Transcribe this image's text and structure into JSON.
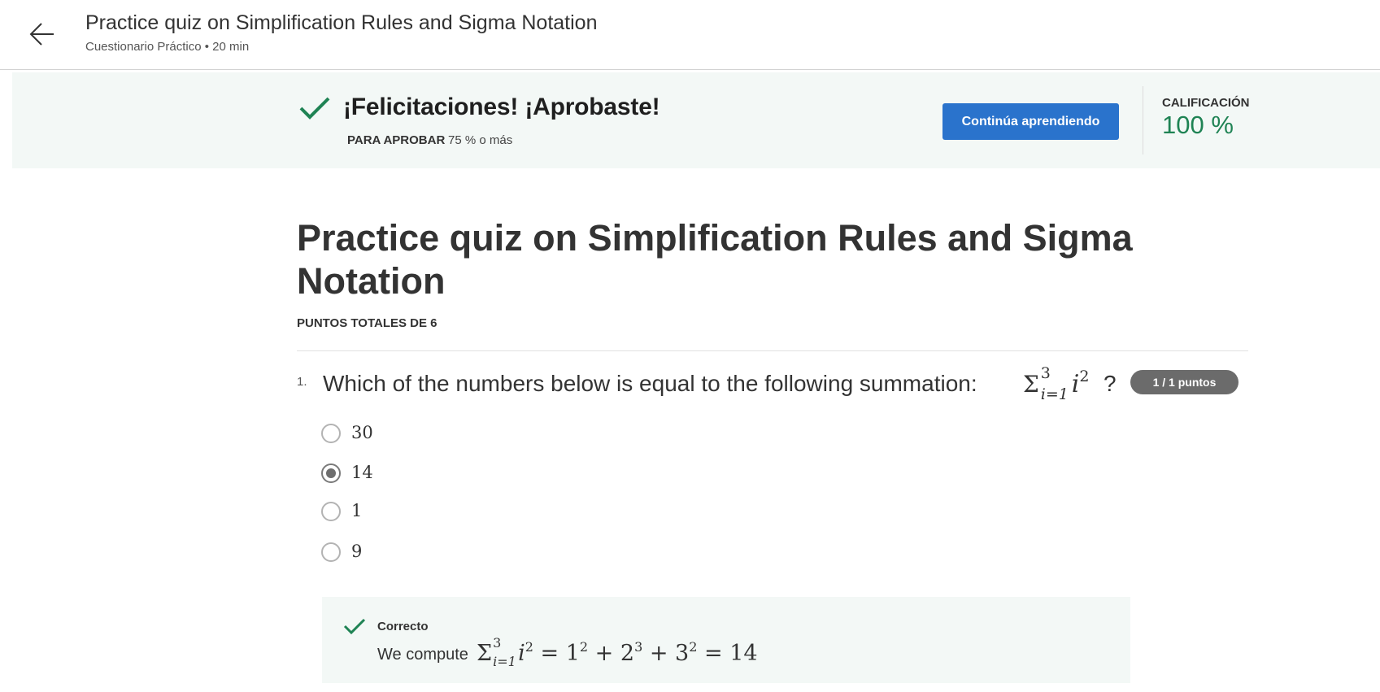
{
  "header": {
    "title": "Practice quiz on Simplification Rules and Sigma Notation",
    "subtitle": "Cuestionario Práctico • 20 min",
    "back_icon": "arrow-left-icon"
  },
  "banner": {
    "message": "¡Felicitaciones! ¡Aprobaste!",
    "pass_label": "PARA APROBAR",
    "pass_value": "75 % o más",
    "continue_label": "Continúa aprendiendo",
    "grade_label": "CALIFICACIÓN",
    "grade_value": "100 %",
    "success_color": "#1f8354",
    "button_color": "#2a73cc"
  },
  "main": {
    "title": "Practice quiz on Simplification Rules and Sigma Notation",
    "points_total": "PUNTOS TOTALES DE 6"
  },
  "questions": [
    {
      "number": "1.",
      "text": "Which of the numbers below is equal to the following summation:",
      "math": {
        "sigma": "Σ",
        "upper": "3",
        "lower": "i=1",
        "variable": "i",
        "exponent": "2"
      },
      "question_mark": "?",
      "points_badge": "1 / 1 puntos",
      "options": [
        {
          "label": "30",
          "selected": false
        },
        {
          "label": "14",
          "selected": true
        },
        {
          "label": "1",
          "selected": false
        },
        {
          "label": "9",
          "selected": false
        }
      ],
      "feedback": {
        "title": "Correcto",
        "text_prefix": "We compute",
        "math": {
          "sigma": "Σ",
          "upper": "3",
          "lower": "i=1",
          "variable": "i",
          "exponent": "2",
          "equation": "= 1",
          "e1": "2",
          "plus_two": " + 2",
          "e2": "3",
          "plus_three": " + 3",
          "e3": "2",
          "result": " = 14"
        }
      }
    }
  ]
}
